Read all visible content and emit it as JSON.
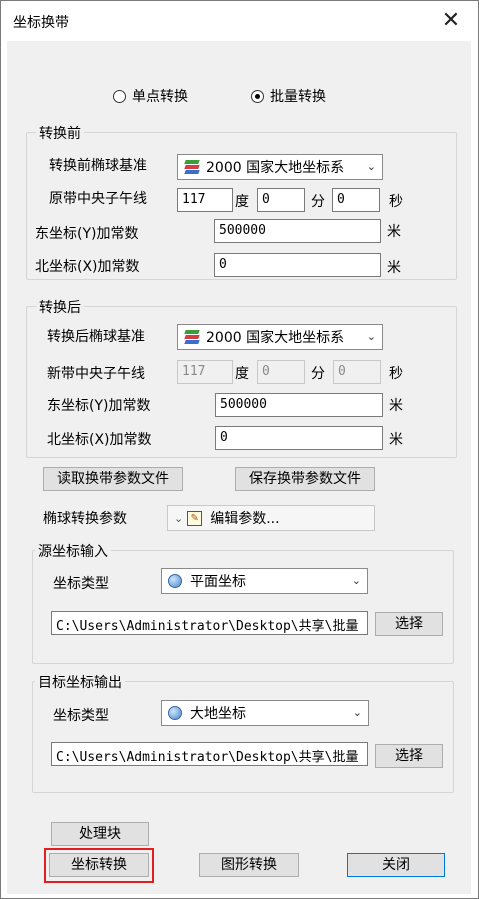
{
  "window": {
    "title": "坐标换带",
    "close_glyph": "✕"
  },
  "mode": {
    "single": "单点转换",
    "batch": "批量转换",
    "selected": "batch"
  },
  "before": {
    "title": "转换前",
    "ellipsoid_label": "转换前椭球基准",
    "ellipsoid_value": "2000 国家大地坐标系",
    "meridian_label": "原带中央子午线",
    "deg": "117",
    "deg_unit": "度",
    "min": "0",
    "min_unit": "分",
    "sec": "0",
    "sec_unit": "秒",
    "east_label": "东坐标(Y)加常数",
    "east_value": "500000",
    "east_unit": "米",
    "north_label": "北坐标(X)加常数",
    "north_value": "0",
    "north_unit": "米"
  },
  "after": {
    "title": "转换后",
    "ellipsoid_label": "转换后椭球基准",
    "ellipsoid_value": "2000 国家大地坐标系",
    "meridian_label": "新带中央子午线",
    "deg": "117",
    "deg_unit": "度",
    "min": "0",
    "min_unit": "分",
    "sec": "0",
    "sec_unit": "秒",
    "east_label": "东坐标(Y)加常数",
    "east_value": "500000",
    "east_unit": "米",
    "north_label": "北坐标(X)加常数",
    "north_value": "0",
    "north_unit": "米"
  },
  "buttons": {
    "read_params": "读取换带参数文件",
    "save_params": "保存换带参数文件",
    "process_block": "处理块",
    "coord_convert": "坐标转换",
    "graphic_convert": "图形转换",
    "close": "关闭"
  },
  "ellipsoid_params": {
    "label": "椭球转换参数",
    "value": "编辑参数..."
  },
  "source": {
    "title": "源坐标输入",
    "type_label": "坐标类型",
    "type_value": "平面坐标",
    "path": "C:\\Users\\Administrator\\Desktop\\共享\\批量",
    "select": "选择"
  },
  "target": {
    "title": "目标坐标输出",
    "type_label": "坐标类型",
    "type_value": "大地坐标",
    "path": "C:\\Users\\Administrator\\Desktop\\共享\\批量",
    "select": "选择"
  },
  "colors": {
    "highlight": "#e02020",
    "dialog_bg": "#f0f0f0",
    "button_bg": "#e1e1e1"
  },
  "icons": [
    "close-icon",
    "layers-icon",
    "globe-icon",
    "edit-icon",
    "chevron-down-icon"
  ]
}
